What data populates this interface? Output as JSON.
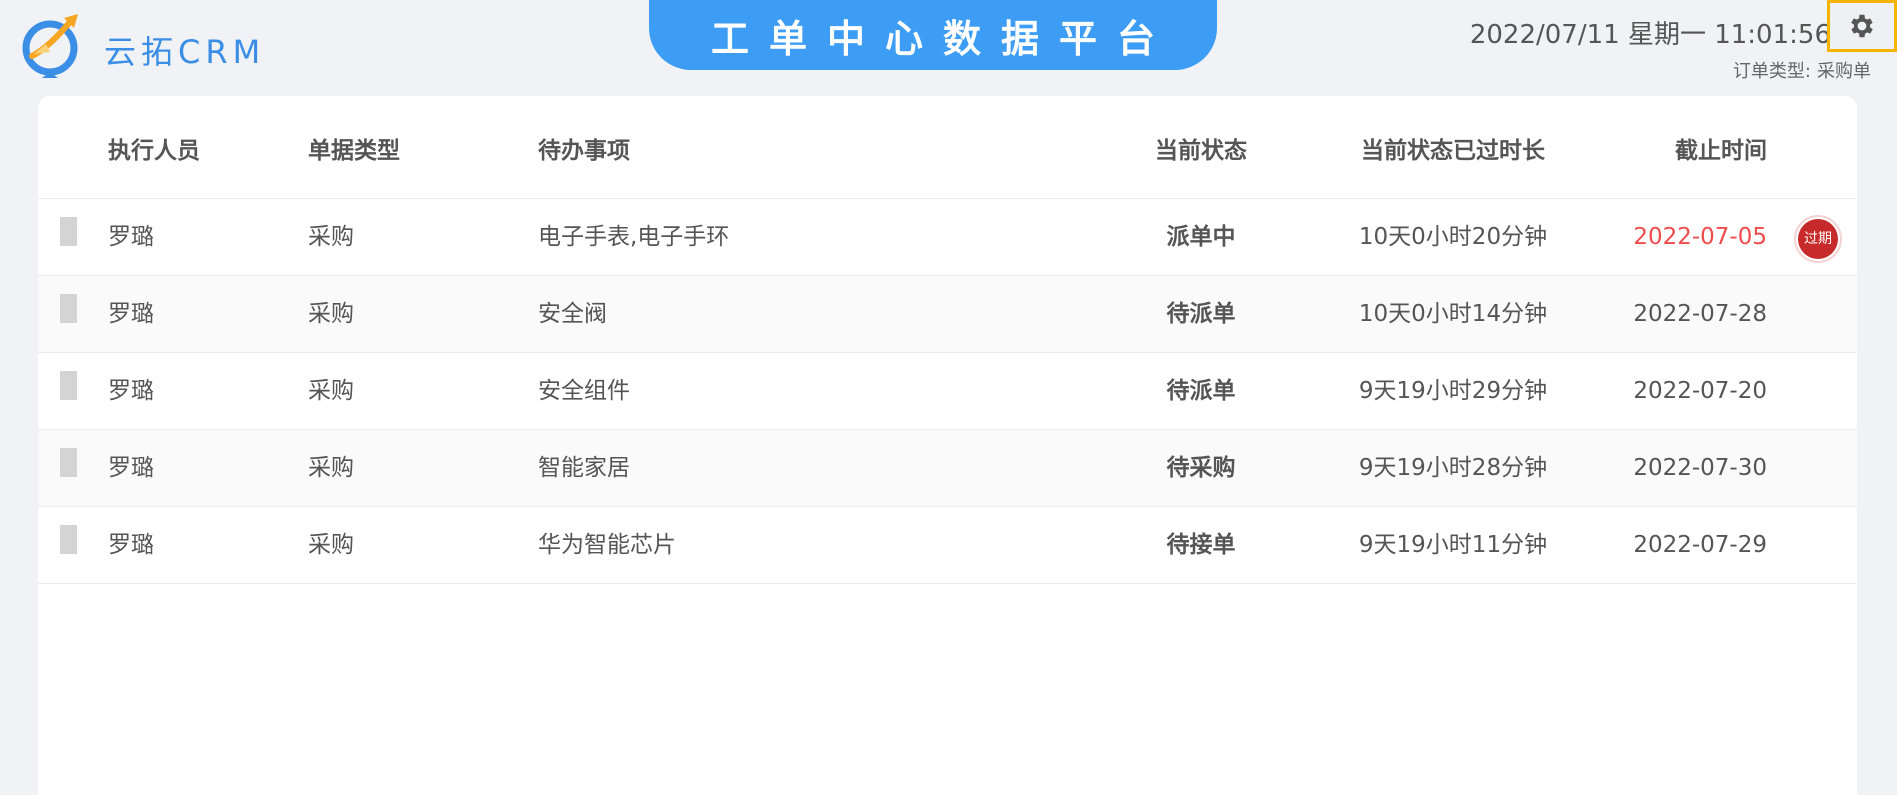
{
  "header": {
    "brand": "云拓CRM",
    "title": "工单中心数据平台",
    "datetime": "2022/07/11 星期一 11:01:56",
    "order_type_label": "订单类型:",
    "order_type_value": "采购单",
    "settings_icon": "gear-icon",
    "logo_icon": "rocket-target-logo"
  },
  "colors": {
    "banner": "#3d9cf4",
    "brand": "#3a8ee6",
    "overdue": "#f04c4c",
    "badge": "#c72a2a",
    "settings_border": "#f5b400"
  },
  "table": {
    "columns": [
      "执行人员",
      "单据类型",
      "待办事项",
      "当前状态",
      "当前状态已过时长",
      "截止时间"
    ],
    "rows": [
      {
        "person": "罗璐",
        "type": "采购",
        "todo": "电子手表,电子手环",
        "status": "派单中",
        "duration": "10天0小时20分钟",
        "deadline": "2022-07-05",
        "badge": "过期"
      },
      {
        "person": "罗璐",
        "type": "采购",
        "todo": "安全阀",
        "status": "待派单",
        "duration": "10天0小时14分钟",
        "deadline": "2022-07-28"
      },
      {
        "person": "罗璐",
        "type": "采购",
        "todo": "安全组件",
        "status": "待派单",
        "duration": "9天19小时29分钟",
        "deadline": "2022-07-20"
      },
      {
        "person": "罗璐",
        "type": "采购",
        "todo": "智能家居",
        "status": "待采购",
        "duration": "9天19小时28分钟",
        "deadline": "2022-07-30"
      },
      {
        "person": "罗璐",
        "type": "采购",
        "todo": "华为智能芯片",
        "status": "待接单",
        "duration": "9天19小时11分钟",
        "deadline": "2022-07-29"
      }
    ]
  }
}
